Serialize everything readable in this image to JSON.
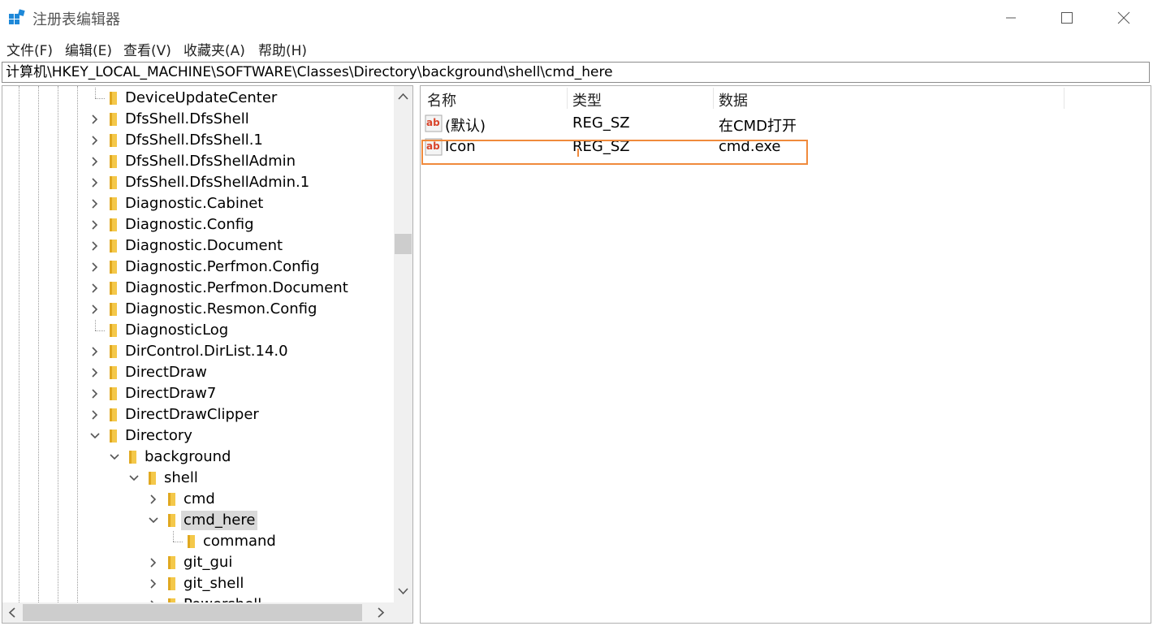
{
  "window": {
    "title": "注册表编辑器",
    "controls": [
      "minimize",
      "maximize",
      "close"
    ]
  },
  "menu": [
    "文件(F)",
    "编辑(E)",
    "查看(V)",
    "收藏夹(A)",
    "帮助(H)"
  ],
  "address": "计算机\\HKEY_LOCAL_MACHINE\\SOFTWARE\\Classes\\Directory\\background\\shell\\cmd_here",
  "tree": {
    "items": [
      {
        "label": "DeviceUpdateCenter",
        "depth": 0,
        "expander": "none"
      },
      {
        "label": "DfsShell.DfsShell",
        "depth": 0,
        "expander": "collapsed"
      },
      {
        "label": "DfsShell.DfsShell.1",
        "depth": 0,
        "expander": "collapsed"
      },
      {
        "label": "DfsShell.DfsShellAdmin",
        "depth": 0,
        "expander": "collapsed"
      },
      {
        "label": "DfsShell.DfsShellAdmin.1",
        "depth": 0,
        "expander": "collapsed"
      },
      {
        "label": "Diagnostic.Cabinet",
        "depth": 0,
        "expander": "collapsed"
      },
      {
        "label": "Diagnostic.Config",
        "depth": 0,
        "expander": "collapsed"
      },
      {
        "label": "Diagnostic.Document",
        "depth": 0,
        "expander": "collapsed"
      },
      {
        "label": "Diagnostic.Perfmon.Config",
        "depth": 0,
        "expander": "collapsed"
      },
      {
        "label": "Diagnostic.Perfmon.Document",
        "depth": 0,
        "expander": "collapsed"
      },
      {
        "label": "Diagnostic.Resmon.Config",
        "depth": 0,
        "expander": "collapsed"
      },
      {
        "label": "DiagnosticLog",
        "depth": 0,
        "expander": "none"
      },
      {
        "label": "DirControl.DirList.14.0",
        "depth": 0,
        "expander": "collapsed"
      },
      {
        "label": "DirectDraw",
        "depth": 0,
        "expander": "collapsed"
      },
      {
        "label": "DirectDraw7",
        "depth": 0,
        "expander": "collapsed"
      },
      {
        "label": "DirectDrawClipper",
        "depth": 0,
        "expander": "collapsed"
      },
      {
        "label": "Directory",
        "depth": 0,
        "expander": "expanded"
      },
      {
        "label": "background",
        "depth": 1,
        "expander": "expanded"
      },
      {
        "label": "shell",
        "depth": 2,
        "expander": "expanded"
      },
      {
        "label": "cmd",
        "depth": 3,
        "expander": "collapsed"
      },
      {
        "label": "cmd_here",
        "depth": 3,
        "expander": "expanded",
        "selected": true
      },
      {
        "label": "command",
        "depth": 4,
        "expander": "none"
      },
      {
        "label": "git_gui",
        "depth": 3,
        "expander": "collapsed"
      },
      {
        "label": "git_shell",
        "depth": 3,
        "expander": "collapsed"
      },
      {
        "label": "Powershell",
        "depth": 3,
        "expander": "collapsed"
      }
    ]
  },
  "values": {
    "columns": [
      "名称",
      "类型",
      "数据"
    ],
    "rows": [
      {
        "name": "(默认)",
        "type": "REG_SZ",
        "data": "在CMD打开"
      },
      {
        "name": "Icon",
        "type": "REG_SZ",
        "data": "cmd.exe",
        "highlighted": true
      }
    ]
  },
  "colors": {
    "folder": "#f4c84a",
    "selection": "#d9d9d9",
    "highlight_box": "#f08a3c",
    "ab_icon": "#d9452b"
  },
  "icons": {
    "app": "regedit-icon",
    "folder": "folder-icon",
    "value": "string-value-icon"
  }
}
